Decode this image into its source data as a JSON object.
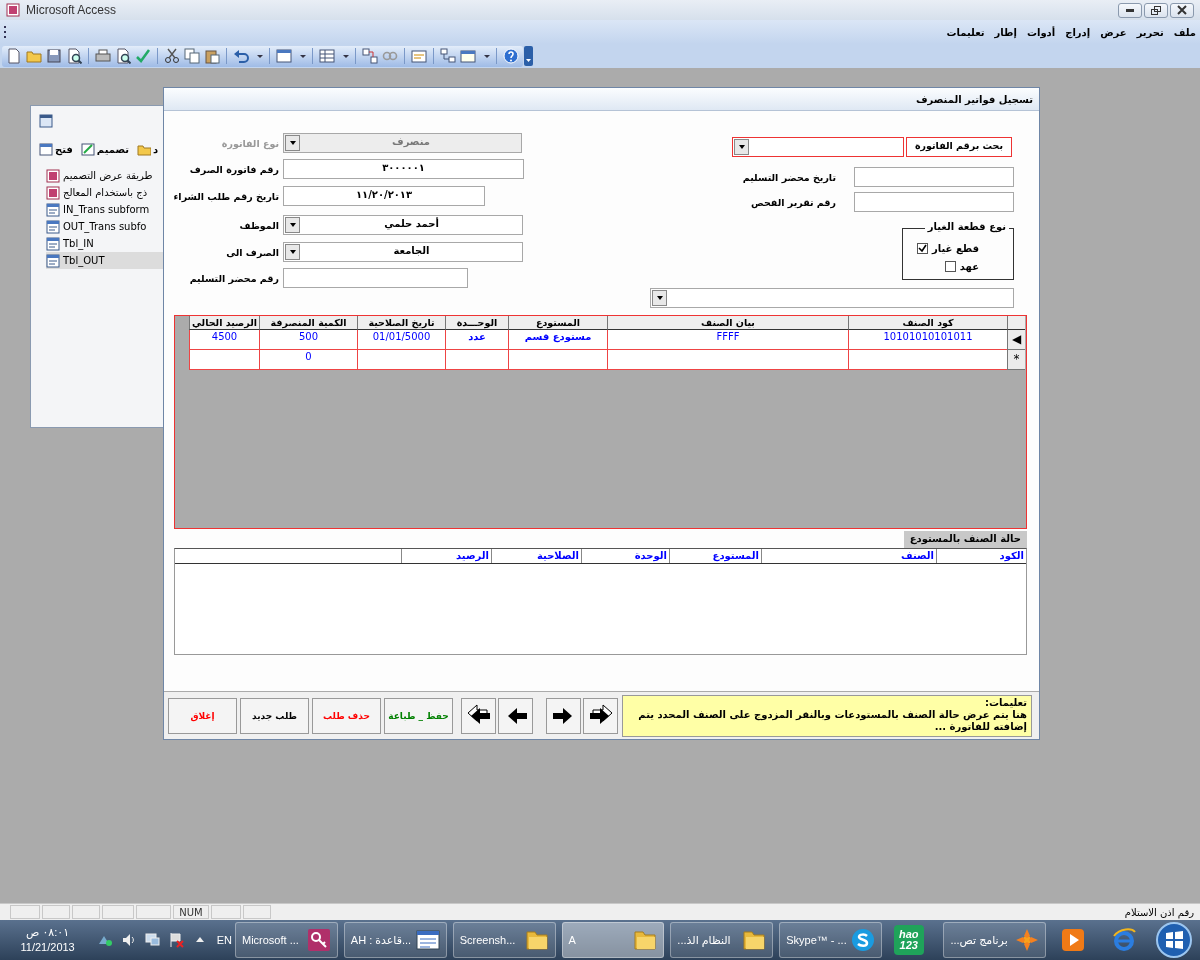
{
  "window": {
    "title": "Microsoft Access"
  },
  "menu": [
    "ملف",
    "تحرير",
    "عرض",
    "إدراج",
    "أدوات",
    "إطار",
    "تعليمات"
  ],
  "db_window": {
    "toolbar": [
      "د",
      "تصميم",
      "فتح"
    ],
    "items": [
      {
        "kind": "create",
        "label": "طريقة عرض التصميم",
        "selected": false
      },
      {
        "kind": "create",
        "label": "ذج باستخدام المعالج",
        "selected": false
      },
      {
        "kind": "form",
        "label": "IN_Trans subform",
        "selected": false
      },
      {
        "kind": "form",
        "label": "OUT_Trans subfo",
        "selected": false
      },
      {
        "kind": "form",
        "label": "Tbl_IN",
        "selected": false
      },
      {
        "kind": "form",
        "label": "Tbl_OUT",
        "selected": true
      }
    ]
  },
  "form": {
    "title": "تسجيل فواتير المنصرف",
    "search": {
      "label": "بحث برقم الفاتورة"
    },
    "right_fields": [
      {
        "label": "تاريخ محضر التسليم"
      },
      {
        "label": "رقم تقرير الفحص"
      }
    ],
    "option_group": {
      "legend": "نوع قطعة الغيار",
      "options": [
        {
          "label": "قطع غيار",
          "checked": true
        },
        {
          "label": "عهد",
          "checked": false
        }
      ]
    },
    "left_fields": [
      {
        "label": "نوع الفاتورة",
        "kind": "combo",
        "value": "منصرف",
        "disabled": true
      },
      {
        "label": "رقم فاتورة الصرف",
        "kind": "text",
        "value": "٣٠٠٠٠٠١",
        "disabled": false
      },
      {
        "label": "تاريخ رقم طلب الشراء",
        "kind": "text",
        "value": "١١/٢٠/٢٠١٣",
        "disabled": false
      },
      {
        "label": "الموظف",
        "kind": "combo",
        "value": "أحمد حلمي",
        "disabled": false
      },
      {
        "label": "الصرف الى",
        "kind": "combo",
        "value": "الجامعة",
        "disabled": false
      },
      {
        "label": "رقم محضر التسليم",
        "kind": "text",
        "disabled": false
      }
    ],
    "datasheet": {
      "columns": [
        "كود الصنف",
        "بيان الصنف",
        "المستودع",
        "الوحـــدة",
        "تاريخ الصلاحية",
        "الكمية المنصرفة",
        "الرصيد الحالي"
      ],
      "rows": [
        {
          "selector": "◀",
          "cells": [
            "10101010101011",
            "FFFF",
            "مستودع قسم",
            "عدد",
            "01/01/5000",
            "500",
            "4500"
          ]
        },
        {
          "selector": "*",
          "cells": [
            null,
            null,
            null,
            null,
            null,
            "0",
            null
          ]
        }
      ]
    },
    "stock_panel": {
      "tab": "حالة الصنف بالمستودع",
      "columns": [
        "الكود",
        "الصنف",
        "المستودع",
        "الوحدة",
        "الصلاحية",
        "الرصيد"
      ]
    },
    "instructions": {
      "title": "تعليمات:",
      "text": "هنا يتم عرض حالة الصنف بالمستودعات وبالنقر المزدوج على الصنف المحدد يتم إضافته للفاتورة ..."
    },
    "nav_buttons": [
      {
        "kind": "last"
      },
      {
        "kind": "next"
      },
      {
        "kind": "previous"
      },
      {
        "kind": "first"
      }
    ],
    "buttons": [
      {
        "label": "حفظ _ طباعة",
        "color": "#008000"
      },
      {
        "label": "حذف طلب",
        "color": "#ff0000"
      },
      {
        "label": "طلب جديد",
        "color": "#000000"
      },
      {
        "label": "إغلاق",
        "color": "#ff0000"
      }
    ]
  },
  "status_bar": {
    "text": "رقم اذن الاستلام",
    "indicators": [
      "NUM"
    ]
  },
  "taskbar": {
    "tasks": [
      {
        "kind": "browser",
        "selected": false
      },
      {
        "kind": "media",
        "selected": false
      },
      {
        "kind": "app",
        "label": "برنامج تص...",
        "selected": false
      },
      {
        "kind": "logo",
        "logo": [
          "hao",
          "123"
        ],
        "selected": false
      },
      {
        "kind": "skype",
        "label": "Skype™ - ...",
        "selected": false
      },
      {
        "kind": "folder",
        "label": "النظام الذ...",
        "selected": false
      },
      {
        "kind": "folder",
        "label": "A",
        "selected": true
      },
      {
        "kind": "folder",
        "label": "Screensh...",
        "selected": false
      },
      {
        "kind": "database",
        "label": "AH : قاعدة...",
        "selected": false
      },
      {
        "kind": "access",
        "label": "Microsoft ...",
        "selected": false
      }
    ],
    "tray": {
      "language": "EN",
      "time": "٠٨:٠١ ص",
      "date": "11/21/2013"
    }
  }
}
